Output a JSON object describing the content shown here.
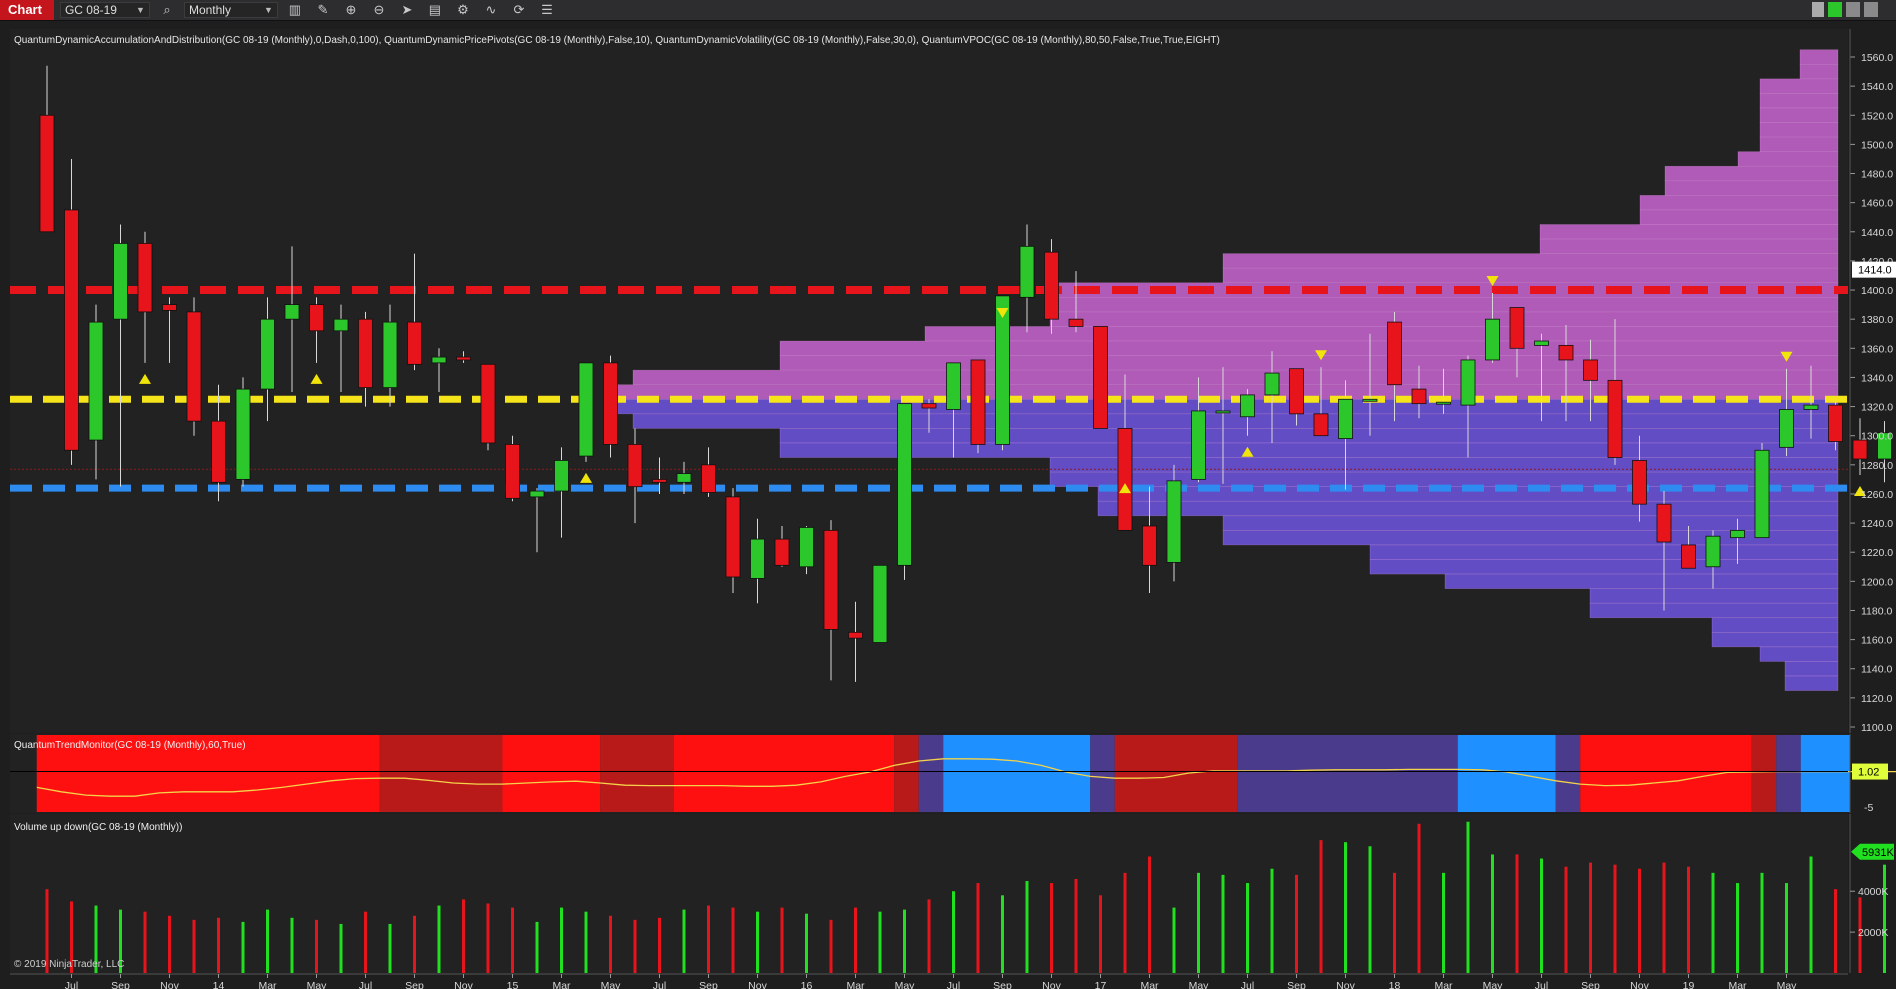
{
  "toolbar": {
    "tab_label": "Chart",
    "instrument": "GC 08-19",
    "timeframe": "Monthly",
    "icons": [
      "bar-chart-icon",
      "pencil-icon",
      "zoom-in-icon",
      "zoom-out-icon",
      "pointer-icon",
      "properties-icon",
      "strategy-icon",
      "indicator-icon",
      "refresh-icon",
      "data-box-icon"
    ]
  },
  "price_panel": {
    "indicators_text": "QuantumDynamicAccumulationAndDistribution(GC 08-19 (Monthly),0,Dash,0,100), QuantumDynamicPricePivots(GC 08-19 (Monthly),False,10), QuantumDynamicVolatility(GC 08-19 (Monthly),False,30,0), QuantumVPOC(GC 08-19 (Monthly),80,50,False,True,True,EIGHT)",
    "price_labels": [
      "1560.0",
      "1540.0",
      "1520.0",
      "1500.0",
      "1480.0",
      "1460.0",
      "1440.0",
      "1420.0",
      "1400.0",
      "1380.0",
      "1360.0",
      "1340.0",
      "1320.0",
      "1300.0",
      "1280.0",
      "1260.0",
      "1240.0",
      "1220.0",
      "1200.0",
      "1180.0",
      "1160.0",
      "1140.0",
      "1120.0",
      "1100.0"
    ],
    "last_price": "1414.0",
    "levels": {
      "red": 1400,
      "yellow": 1325,
      "blue": 1264
    },
    "colors": {
      "up": "#2bc72b",
      "down": "#e8141b",
      "red_line": "#e8141b",
      "yellow_line": "#f5e41a",
      "blue_line": "#2e8bf0",
      "pivot": "#f0e40a"
    }
  },
  "chart_data": [
    {
      "type": "candlestick",
      "title": "GC 08-19 (Monthly)",
      "ohlc": [
        [
          1520,
          1554,
          1450,
          1440
        ],
        [
          1455,
          1490,
          1280,
          1290
        ],
        [
          1297,
          1390,
          1270,
          1378
        ],
        [
          1380,
          1445,
          1265,
          1432
        ],
        [
          1432,
          1440,
          1350,
          1385
        ],
        [
          1390,
          1395,
          1350,
          1386
        ],
        [
          1385,
          1395,
          1300,
          1310
        ],
        [
          1310,
          1335,
          1255,
          1268
        ],
        [
          1270,
          1340,
          1265,
          1332
        ],
        [
          1332,
          1395,
          1310,
          1380
        ],
        [
          1380,
          1430,
          1330,
          1390
        ],
        [
          1390,
          1395,
          1350,
          1372
        ],
        [
          1372,
          1390,
          1330,
          1380
        ],
        [
          1380,
          1385,
          1320,
          1333
        ],
        [
          1333,
          1390,
          1320,
          1378
        ],
        [
          1378,
          1425,
          1345,
          1349
        ],
        [
          1350,
          1360,
          1330,
          1354
        ],
        [
          1354,
          1358,
          1350,
          1352
        ],
        [
          1349,
          1347,
          1290,
          1295
        ],
        [
          1294,
          1300,
          1255,
          1257
        ],
        [
          1258,
          1264,
          1220,
          1262
        ],
        [
          1262,
          1292,
          1230,
          1283
        ],
        [
          1286,
          1350,
          1282,
          1350
        ],
        [
          1350,
          1355,
          1285,
          1294
        ],
        [
          1294,
          1305,
          1240,
          1265
        ],
        [
          1270,
          1285,
          1260,
          1268
        ],
        [
          1268,
          1282,
          1260,
          1274
        ],
        [
          1280,
          1292,
          1258,
          1261
        ],
        [
          1258,
          1264,
          1192,
          1203
        ],
        [
          1202,
          1243,
          1185,
          1229
        ],
        [
          1229,
          1238,
          1210,
          1211
        ],
        [
          1210,
          1238,
          1205,
          1237
        ],
        [
          1235,
          1242,
          1132,
          1167
        ],
        [
          1165,
          1186,
          1131,
          1161
        ],
        [
          1158,
          1195,
          1160,
          1211
        ],
        [
          1211,
          1272,
          1201,
          1322
        ],
        [
          1322,
          1325,
          1302,
          1319
        ],
        [
          1318,
          1346,
          1285,
          1350
        ],
        [
          1352,
          1350,
          1288,
          1294
        ],
        [
          1294,
          1376,
          1290,
          1396
        ],
        [
          1395,
          1445,
          1371,
          1430
        ],
        [
          1426,
          1435,
          1370,
          1380
        ],
        [
          1380,
          1413,
          1371,
          1375
        ],
        [
          1375,
          1375,
          1312,
          1305
        ],
        [
          1305,
          1342,
          1275,
          1235
        ],
        [
          1238,
          1265,
          1192,
          1211
        ],
        [
          1213,
          1280,
          1200,
          1269
        ],
        [
          1270,
          1340,
          1268,
          1317
        ],
        [
          1316,
          1347,
          1267,
          1317
        ],
        [
          1313,
          1332,
          1300,
          1328
        ],
        [
          1328,
          1358,
          1295,
          1343
        ],
        [
          1346,
          1346,
          1307,
          1315
        ],
        [
          1315,
          1347,
          1310,
          1300
        ],
        [
          1298,
          1338,
          1263,
          1325
        ],
        [
          1325,
          1370,
          1300,
          1325
        ],
        [
          1378,
          1385,
          1310,
          1335
        ],
        [
          1332,
          1348,
          1312,
          1322
        ],
        [
          1322,
          1346,
          1315,
          1323
        ],
        [
          1321,
          1355,
          1285,
          1352
        ],
        [
          1352,
          1398,
          1350,
          1380
        ],
        [
          1388,
          1388,
          1340,
          1360
        ],
        [
          1362,
          1370,
          1310,
          1365
        ],
        [
          1362,
          1376,
          1310,
          1352
        ],
        [
          1352,
          1366,
          1310,
          1338
        ],
        [
          1338,
          1380,
          1280,
          1285
        ],
        [
          1283,
          1300,
          1241,
          1253
        ],
        [
          1253,
          1262,
          1180,
          1227
        ],
        [
          1225,
          1238,
          1209,
          1209
        ],
        [
          1210,
          1235,
          1195,
          1231
        ],
        [
          1230,
          1243,
          1212,
          1235
        ],
        [
          1230,
          1295,
          1230,
          1290
        ],
        [
          1292,
          1346,
          1286,
          1318
        ],
        [
          1318,
          1348,
          1298,
          1321
        ],
        [
          1321,
          1324,
          1290,
          1296
        ],
        [
          1297,
          1312,
          1273,
          1284
        ],
        [
          1284,
          1310,
          1268,
          1302
        ],
        [
          1304,
          1422,
          1300,
          1414
        ]
      ],
      "pivots_high_index": [
        39,
        52,
        59,
        71
      ],
      "pivots_low_index": [
        4,
        11,
        22,
        44,
        49,
        74
      ],
      "x_tick_labels": [
        [
          "Jul",
          1
        ],
        [
          "Sep",
          3
        ],
        [
          "Nov",
          5
        ],
        [
          "14",
          7
        ],
        [
          "Mar",
          9
        ],
        [
          "May",
          11
        ],
        [
          "Jul",
          13
        ],
        [
          "Sep",
          15
        ],
        [
          "Nov",
          17
        ],
        [
          "15",
          19
        ],
        [
          "Mar",
          21
        ],
        [
          "May",
          23
        ],
        [
          "Jul",
          25
        ],
        [
          "Sep",
          27
        ],
        [
          "Nov",
          29
        ],
        [
          "16",
          31
        ],
        [
          "Mar",
          33
        ],
        [
          "May",
          35
        ],
        [
          "Jul",
          37
        ],
        [
          "Sep",
          39
        ],
        [
          "Nov",
          41
        ],
        [
          "17",
          43
        ],
        [
          "Mar",
          45
        ],
        [
          "May",
          47
        ],
        [
          "Jul",
          49
        ],
        [
          "Sep",
          51
        ],
        [
          "Nov",
          53
        ],
        [
          "18",
          55
        ],
        [
          "Mar",
          57
        ],
        [
          "May",
          59
        ],
        [
          "Jul",
          61
        ],
        [
          "Sep",
          63
        ],
        [
          "Nov",
          65
        ],
        [
          "19",
          67
        ],
        [
          "Mar",
          69
        ],
        [
          "May",
          71
        ]
      ],
      "yticks": [
        1560,
        1540,
        1520,
        1500,
        1480,
        1460,
        1440,
        1420,
        1400,
        1380,
        1360,
        1340,
        1320,
        1300,
        1280,
        1260,
        1240,
        1220,
        1200,
        1180,
        1160,
        1140,
        1120,
        1100
      ],
      "ylim": [
        1095,
        1580
      ]
    },
    {
      "type": "line",
      "title": "QuantumTrendMonitor(GC 08-19 (Monthly),60,True)",
      "value_label": "1.02",
      "tick_label": "-5",
      "zones": [
        {
          "start": 0,
          "end": 14,
          "color": "#ff1010"
        },
        {
          "start": 14,
          "end": 19,
          "color": "#b81a1a"
        },
        {
          "start": 19,
          "end": 23,
          "color": "#ff1010"
        },
        {
          "start": 23,
          "end": 26,
          "color": "#b81a1a"
        },
        {
          "start": 26,
          "end": 35,
          "color": "#ff1010"
        },
        {
          "start": 35,
          "end": 36,
          "color": "#b81a1a"
        },
        {
          "start": 36,
          "end": 37,
          "color": "#4b3b8c"
        },
        {
          "start": 37,
          "end": 43,
          "color": "#1e90ff"
        },
        {
          "start": 43,
          "end": 44,
          "color": "#4b3b8c"
        },
        {
          "start": 44,
          "end": 49,
          "color": "#b81a1a"
        },
        {
          "start": 49,
          "end": 58,
          "color": "#4b3b8c"
        },
        {
          "start": 58,
          "end": 62,
          "color": "#1e90ff"
        },
        {
          "start": 62,
          "end": 63,
          "color": "#4b3b8c"
        },
        {
          "start": 63,
          "end": 70,
          "color": "#ff1010"
        },
        {
          "start": 70,
          "end": 71,
          "color": "#b81a1a"
        },
        {
          "start": 71,
          "end": 72,
          "color": "#4b3b8c"
        },
        {
          "start": 72,
          "end": 74,
          "color": "#1e90ff"
        }
      ],
      "values": [
        0.3,
        0.1,
        -0.05,
        -0.1,
        -0.1,
        0.05,
        0.1,
        0.1,
        0.1,
        0.18,
        0.3,
        0.45,
        0.6,
        0.7,
        0.72,
        0.72,
        0.62,
        0.5,
        0.45,
        0.45,
        0.5,
        0.55,
        0.58,
        0.5,
        0.4,
        0.38,
        0.38,
        0.38,
        0.38,
        0.35,
        0.35,
        0.4,
        0.55,
        0.8,
        1.0,
        1.3,
        1.5,
        1.6,
        1.6,
        1.58,
        1.5,
        1.3,
        1.0,
        0.8,
        0.72,
        0.72,
        0.75,
        0.95,
        1.05,
        1.05,
        1.05,
        1.05,
        1.08,
        1.1,
        1.1,
        1.1,
        1.12,
        1.12,
        1.12,
        1.1,
        1.0,
        0.8,
        0.6,
        0.45,
        0.38,
        0.4,
        0.5,
        0.6,
        0.8,
        0.98,
        1.0,
        1.02,
        1.02,
        1.02,
        1.02,
        1.02,
        1.02
      ]
    },
    {
      "type": "bar",
      "title": "Volume up down(GC 08-19 (Monthly))",
      "last_value_label": "5931K",
      "yticks_labels": [
        "4000K",
        "2000K"
      ],
      "yticks": [
        4000,
        2000
      ],
      "ylim": [
        0,
        6800
      ],
      "values": [
        4100,
        3500,
        3300,
        3100,
        3000,
        2800,
        2600,
        2700,
        2500,
        3100,
        2700,
        2600,
        2400,
        3000,
        2400,
        2800,
        3300,
        3600,
        3400,
        3200,
        2500,
        3200,
        3000,
        2800,
        2600,
        2700,
        3100,
        3300,
        3200,
        3000,
        3200,
        2900,
        2600,
        3200,
        3000,
        3100,
        3600,
        4000,
        4400,
        3800,
        4500,
        4400,
        4600,
        3800,
        4900,
        5700,
        3200,
        4900,
        4800,
        4400,
        5100,
        4800,
        6500,
        6400,
        6200,
        4900,
        7300,
        4900,
        7400,
        5800,
        5800,
        5600,
        5200,
        5400,
        5300,
        5100,
        5400,
        5200,
        4900,
        4400,
        4900,
        4400,
        5700,
        4100,
        3700,
        5300,
        5900
      ]
    }
  ],
  "volume_profile_above": [
    {
      "start_index": 24,
      "end_index": 42,
      "top": 1445,
      "bottom": 1345
    },
    {
      "start_index": 42,
      "end_index": 58,
      "top": 1440,
      "bottom": 1400
    }
  ],
  "copyright": "© 2019 NinjaTrader, LLC"
}
